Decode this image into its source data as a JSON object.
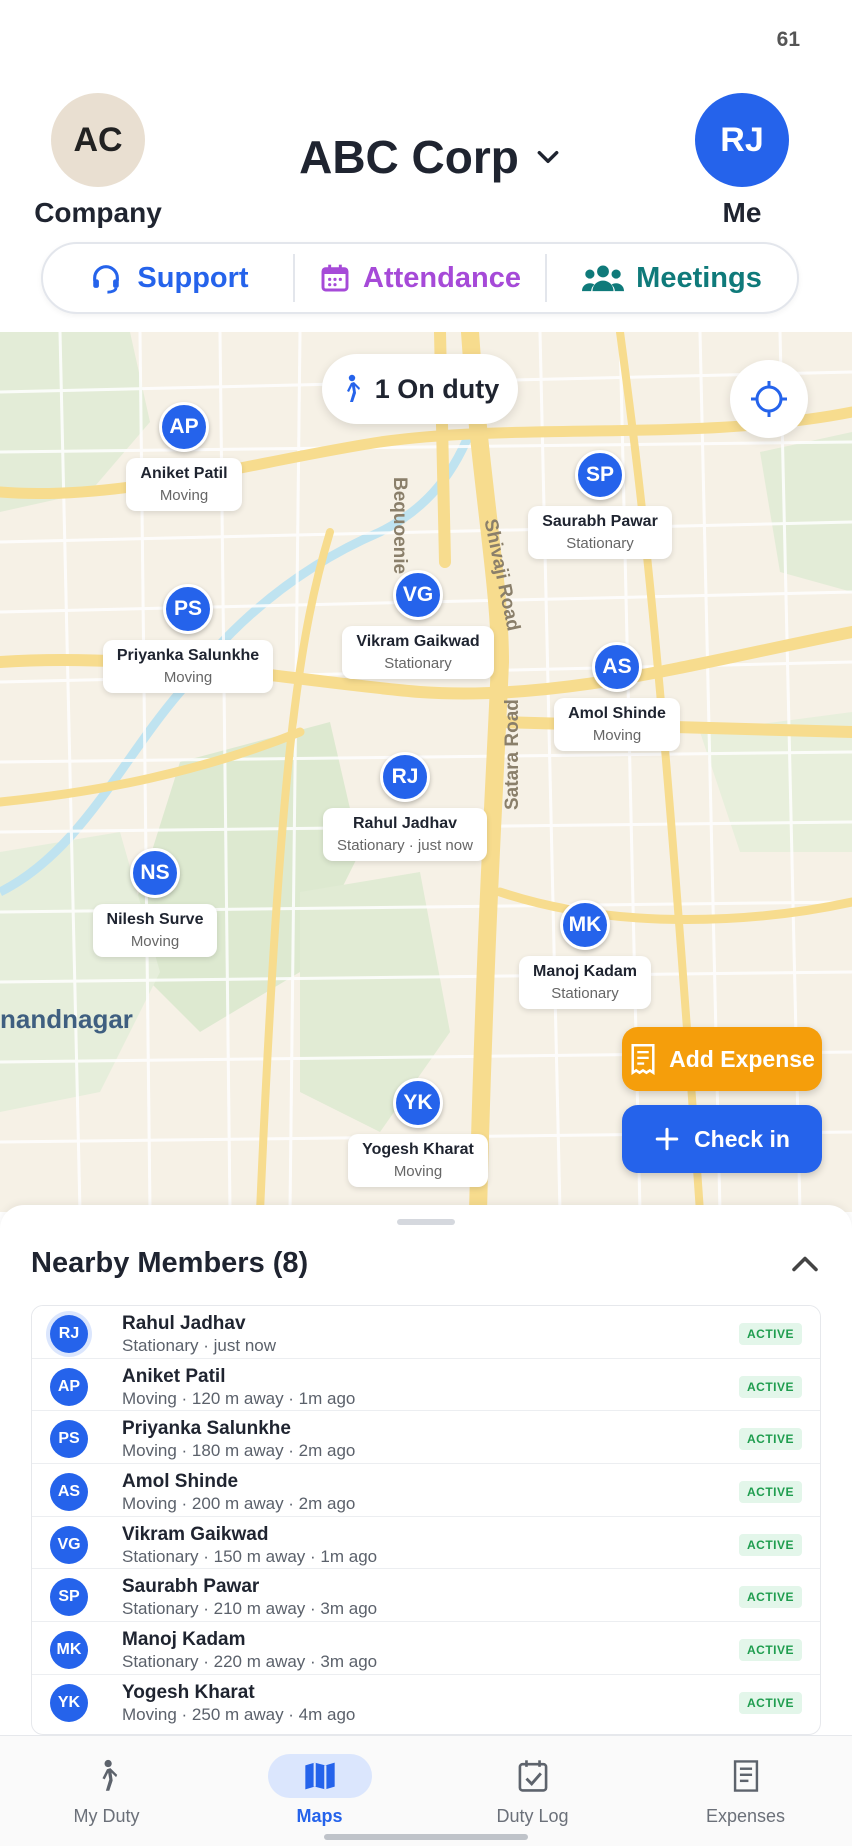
{
  "status_bar": {
    "battery": "61"
  },
  "header": {
    "company_initials": "AC",
    "company_label": "Company",
    "org_name": "ABC Corp",
    "me_initials": "RJ",
    "me_label": "Me"
  },
  "quick_actions": [
    {
      "label": "Support",
      "icon": "headset-icon",
      "color": "#2563eb"
    },
    {
      "label": "Attendance",
      "icon": "calendar-icon",
      "color": "#a64ad8"
    },
    {
      "label": "Meetings",
      "icon": "group-icon",
      "color": "#0f7a7a"
    }
  ],
  "map": {
    "on_duty_label": "1 On duty",
    "area_label": "nandnagar",
    "road_labels": [
      "Shivaji Road",
      "Satara Road",
      "Bequoenie"
    ],
    "markers": [
      {
        "initials": "AP",
        "name": "Aniket Patil",
        "status": "Moving"
      },
      {
        "initials": "SP",
        "name": "Saurabh Pawar",
        "status": "Stationary"
      },
      {
        "initials": "VG",
        "name": "Vikram Gaikwad",
        "status": "Stationary"
      },
      {
        "initials": "PS",
        "name": "Priyanka Salunkhe",
        "status": "Moving"
      },
      {
        "initials": "AS",
        "name": "Amol Shinde",
        "status": "Moving"
      },
      {
        "initials": "RJ",
        "name": "Rahul Jadhav",
        "status": "Stationary · just now"
      },
      {
        "initials": "NS",
        "name": "Nilesh Surve",
        "status": "Moving"
      },
      {
        "initials": "MK",
        "name": "Manoj Kadam",
        "status": "Stationary"
      },
      {
        "initials": "YK",
        "name": "Yogesh Kharat",
        "status": "Moving"
      }
    ],
    "add_expense_label": "Add Expense",
    "check_in_label": "Check in"
  },
  "sheet": {
    "title": "Nearby Members (8)",
    "members": [
      {
        "initials": "RJ",
        "name": "Rahul Jadhav",
        "detail": "Stationary  ·  just now",
        "badge": "ACTIVE"
      },
      {
        "initials": "AP",
        "name": "Aniket Patil",
        "detail": "Moving  ·  120 m away  ·  1m ago",
        "badge": "ACTIVE"
      },
      {
        "initials": "PS",
        "name": "Priyanka Salunkhe",
        "detail": "Moving  ·  180 m away  ·  2m ago",
        "badge": "ACTIVE"
      },
      {
        "initials": "AS",
        "name": "Amol Shinde",
        "detail": "Moving  ·  200 m away  ·  2m ago",
        "badge": "ACTIVE"
      },
      {
        "initials": "VG",
        "name": "Vikram Gaikwad",
        "detail": "Stationary  ·  150 m away  ·  1m ago",
        "badge": "ACTIVE"
      },
      {
        "initials": "SP",
        "name": "Saurabh Pawar",
        "detail": "Stationary  ·  210 m away  ·  3m ago",
        "badge": "ACTIVE"
      },
      {
        "initials": "MK",
        "name": "Manoj Kadam",
        "detail": "Stationary  ·  220 m away  ·  3m ago",
        "badge": "ACTIVE"
      },
      {
        "initials": "YK",
        "name": "Yogesh Kharat",
        "detail": "Moving  ·  250 m away  ·  4m ago",
        "badge": "ACTIVE"
      }
    ]
  },
  "bottom_nav": [
    {
      "label": "My Duty",
      "icon": "walking-icon",
      "active": false
    },
    {
      "label": "Maps",
      "icon": "map-icon",
      "active": true
    },
    {
      "label": "Duty Log",
      "icon": "checklist-icon",
      "active": false
    },
    {
      "label": "Expenses",
      "icon": "receipt-icon",
      "active": false
    }
  ],
  "colors": {
    "primary": "#2563eb",
    "accent": "#f59e0b",
    "active_badge": "#1f9d4f"
  }
}
